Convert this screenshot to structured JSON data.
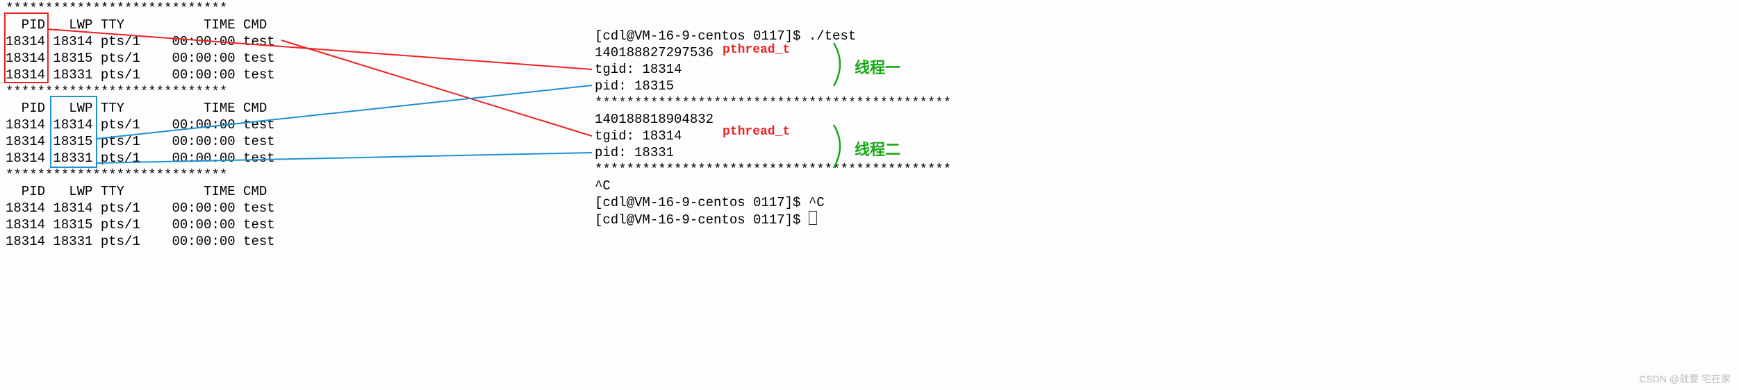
{
  "left": {
    "stars_top": "****************************",
    "header": "  PID   LWP TTY          TIME CMD",
    "rows1": [
      "18314 18314 pts/1    00:00:00 test",
      "18314 18315 pts/1    00:00:00 test",
      "18314 18331 pts/1    00:00:00 test"
    ],
    "stars_mid": "****************************",
    "header2": "  PID   LWP TTY          TIME CMD",
    "rows2": [
      "18314 18314 pts/1    00:00:00 test",
      "18314 18315 pts/1    00:00:00 test",
      "18314 18331 pts/1    00:00:00 test"
    ],
    "stars_bot": "****************************",
    "header3": "  PID   LWP TTY          TIME CMD",
    "rows3": [
      "18314 18314 pts/1    00:00:00 test",
      "18314 18315 pts/1    00:00:00 test",
      "18314 18331 pts/1    00:00:00 test"
    ]
  },
  "right": {
    "prompt1": "[cdl@VM-16-9-centos 0117]$ ./test",
    "t1_id": "140188827297536",
    "t1_tgid": "tgid: 18314",
    "t1_pid": "pid: 18315",
    "stars1": "*********************************************",
    "t2_id": "140188818904832",
    "t2_tgid": "tgid: 18314",
    "t2_pid": "pid: 18331",
    "stars2": "*********************************************",
    "ctrlc": "^C",
    "prompt2": "[cdl@VM-16-9-centos 0117]$ ^C",
    "prompt3": "[cdl@VM-16-9-centos 0117]$ "
  },
  "ann": {
    "pthread_t": "pthread_t",
    "thread1": "线程一",
    "thread2": "线程二"
  },
  "watermark": "CSDN @就要 宅在家",
  "chart_data": {
    "type": "table",
    "title": "ps thread listing & program output",
    "left_table_columns": [
      "PID",
      "LWP",
      "TTY",
      "TIME",
      "CMD"
    ],
    "left_table_rows": [
      [
        18314,
        18314,
        "pts/1",
        "00:00:00",
        "test"
      ],
      [
        18314,
        18315,
        "pts/1",
        "00:00:00",
        "test"
      ],
      [
        18314,
        18331,
        "pts/1",
        "00:00:00",
        "test"
      ]
    ],
    "threads": [
      {
        "label": "线程一",
        "pthread_t": 140188827297536,
        "tgid": 18314,
        "pid": 18315
      },
      {
        "label": "线程二",
        "pthread_t": 140188818904832,
        "tgid": 18314,
        "pid": 18331
      }
    ],
    "mapping_lines": [
      {
        "color": "red",
        "from": "left.block1.PID=18314",
        "to": "right.thread1.tgid"
      },
      {
        "color": "red",
        "from": "left.block1.row1",
        "to": "right.thread2.tgid"
      },
      {
        "color": "blue",
        "from": "left.block2.LWP=18315",
        "to": "right.thread1.pid"
      },
      {
        "color": "blue",
        "from": "left.block2.LWP=18331",
        "to": "right.thread2.pid"
      }
    ]
  }
}
